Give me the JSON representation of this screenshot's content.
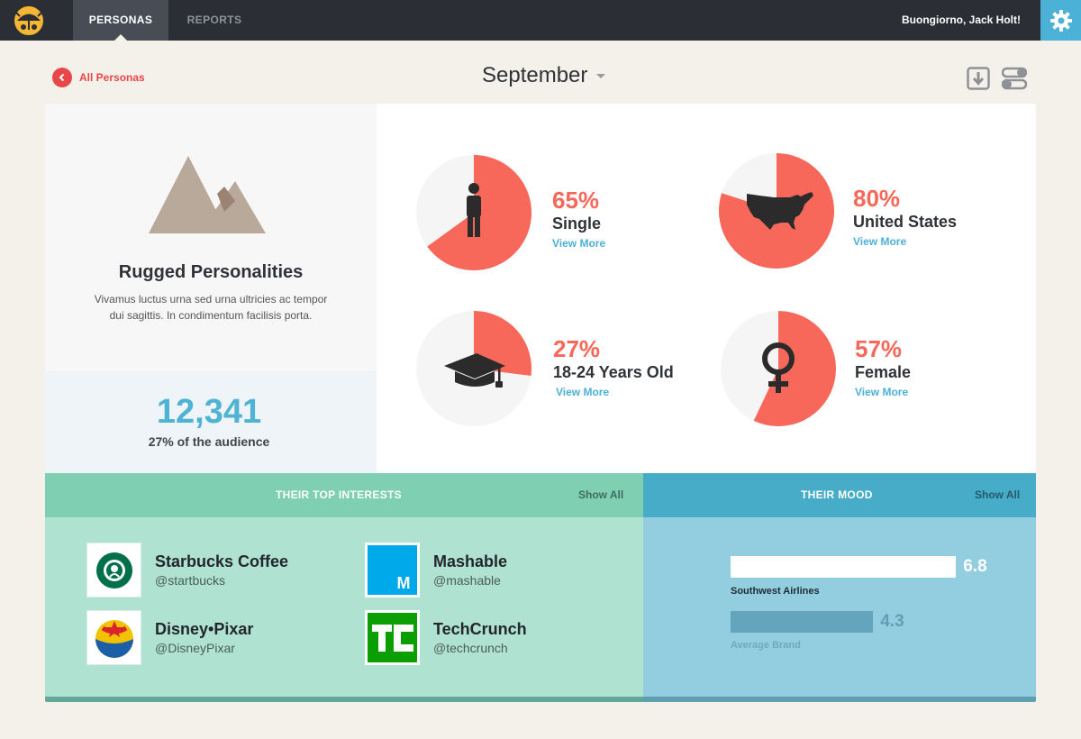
{
  "nav": {
    "tabs": [
      {
        "label": "PERSONAS"
      },
      {
        "label": "REPORTS"
      }
    ],
    "greeting": "Buongiorno, Jack Holt!"
  },
  "subheader": {
    "back_label": "All Personas",
    "month": "September"
  },
  "persona": {
    "name": "Rugged Personalities",
    "description": "Vivamus luctus urna sed urna ultricies ac tempor dui sagittis. In condimentum facilisis porta.",
    "count": "12,341",
    "audience_share": "27% of the audience"
  },
  "stats": [
    {
      "percent_text": "65%",
      "fraction": 0.65,
      "label": "Single",
      "link": "View More",
      "icon": "person-icon"
    },
    {
      "percent_text": "80%",
      "fraction": 0.8,
      "label": "United States",
      "link": "View More",
      "icon": "usa-map-icon"
    },
    {
      "percent_text": "27%",
      "fraction": 0.27,
      "label": "18-24 Years Old",
      "link": "View More",
      "icon": "graduation-cap-icon"
    },
    {
      "percent_text": "57%",
      "fraction": 0.57,
      "label": "Female",
      "link": "View More",
      "icon": "female-symbol-icon"
    }
  ],
  "interests": {
    "title": "THEIR TOP INTERESTS",
    "show_all": "Show All",
    "items": [
      {
        "name": "Starbucks Coffee",
        "handle": "@startbucks"
      },
      {
        "name": "Mashable",
        "handle": "@mashable"
      },
      {
        "name": "Disney•Pixar",
        "handle": "@DisneyPixar"
      },
      {
        "name": "TechCrunch",
        "handle": "@techcrunch"
      }
    ]
  },
  "mood": {
    "title": "THEIR MOOD",
    "show_all": "Show All",
    "max": 10,
    "bars": [
      {
        "name": "Southwest Airlines",
        "value": 6.8,
        "value_text": "6.8"
      },
      {
        "name": "Average Brand",
        "value": 4.3,
        "value_text": "4.3"
      }
    ]
  },
  "colors": {
    "accent_red": "#f7685a",
    "link_blue": "#4cb1d6",
    "interests_green": "#7fcfb2",
    "mood_blue": "#47acc8"
  }
}
